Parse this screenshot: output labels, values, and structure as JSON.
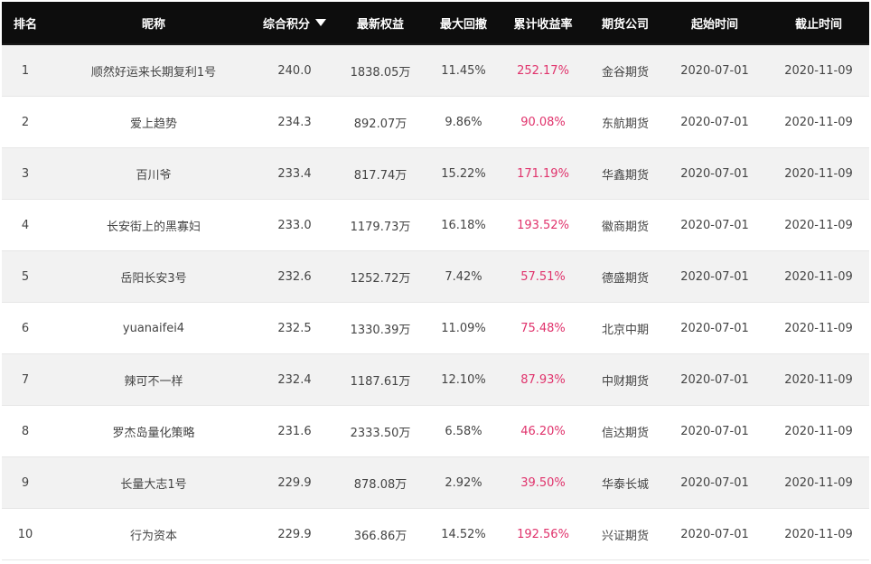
{
  "header": {
    "rank": "排名",
    "nickname": "昵称",
    "score": "综合积分",
    "equity": "最新权益",
    "drawdown": "最大回撤",
    "return": "累计收益率",
    "company": "期货公司",
    "start": "起始时间",
    "end": "截止时间"
  },
  "sort_icon": "caret-down-icon",
  "colors": {
    "header_bg": "#0d0d0d",
    "return_text": "#e0336c",
    "row_alt": "#f2f2f2"
  },
  "rows": [
    {
      "rank": "1",
      "nickname": "顺然好运来长期复利1号",
      "score": "240.0",
      "equity": "1838.05万",
      "drawdown": "11.45%",
      "return": "252.17%",
      "company": "金谷期货",
      "start": "2020-07-01",
      "end": "2020-11-09"
    },
    {
      "rank": "2",
      "nickname": "爱上趋势",
      "score": "234.3",
      "equity": "892.07万",
      "drawdown": "9.86%",
      "return": "90.08%",
      "company": "东航期货",
      "start": "2020-07-01",
      "end": "2020-11-09"
    },
    {
      "rank": "3",
      "nickname": "百川爷",
      "score": "233.4",
      "equity": "817.74万",
      "drawdown": "15.22%",
      "return": "171.19%",
      "company": "华鑫期货",
      "start": "2020-07-01",
      "end": "2020-11-09"
    },
    {
      "rank": "4",
      "nickname": "长安街上的黑寡妇",
      "score": "233.0",
      "equity": "1179.73万",
      "drawdown": "16.18%",
      "return": "193.52%",
      "company": "徽商期货",
      "start": "2020-07-01",
      "end": "2020-11-09"
    },
    {
      "rank": "5",
      "nickname": "岳阳长安3号",
      "score": "232.6",
      "equity": "1252.72万",
      "drawdown": "7.42%",
      "return": "57.51%",
      "company": "德盛期货",
      "start": "2020-07-01",
      "end": "2020-11-09"
    },
    {
      "rank": "6",
      "nickname": "yuanaifei4",
      "score": "232.5",
      "equity": "1330.39万",
      "drawdown": "11.09%",
      "return": "75.48%",
      "company": "北京中期",
      "start": "2020-07-01",
      "end": "2020-11-09"
    },
    {
      "rank": "7",
      "nickname": "辣可不一样",
      "score": "232.4",
      "equity": "1187.61万",
      "drawdown": "12.10%",
      "return": "87.93%",
      "company": "中财期货",
      "start": "2020-07-01",
      "end": "2020-11-09"
    },
    {
      "rank": "8",
      "nickname": "罗杰岛量化策略",
      "score": "231.6",
      "equity": "2333.50万",
      "drawdown": "6.58%",
      "return": "46.20%",
      "company": "信达期货",
      "start": "2020-07-01",
      "end": "2020-11-09"
    },
    {
      "rank": "9",
      "nickname": "长量大志1号",
      "score": "229.9",
      "equity": "878.08万",
      "drawdown": "2.92%",
      "return": "39.50%",
      "company": "华泰长城",
      "start": "2020-07-01",
      "end": "2020-11-09"
    },
    {
      "rank": "10",
      "nickname": "行为资本",
      "score": "229.9",
      "equity": "366.86万",
      "drawdown": "14.52%",
      "return": "192.56%",
      "company": "兴证期货",
      "start": "2020-07-01",
      "end": "2020-11-09"
    }
  ]
}
